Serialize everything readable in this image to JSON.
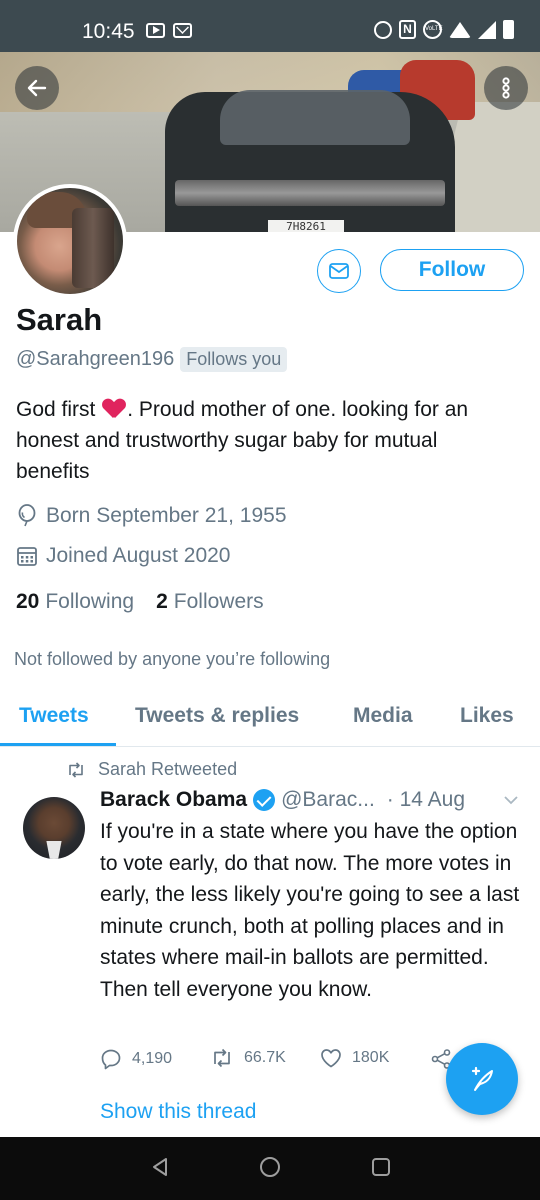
{
  "status_bar": {
    "time": "10:45",
    "nfc_label": "N",
    "volte_label": "VoLTE"
  },
  "header": {
    "license_plate": "7H8261"
  },
  "profile": {
    "display_name": "Sarah",
    "handle": "@Sarahgreen196",
    "follows_you_badge": "Follows you",
    "bio_part1": "God first",
    "bio_part2": ". Proud mother of one. looking for an honest and trustworthy sugar baby for mutual benefits",
    "born": "Born September 21, 1955",
    "joined": "Joined August 2020",
    "following_count": "20",
    "following_label": "Following",
    "followers_count": "2",
    "followers_label": "Followers",
    "not_followed_text": "Not followed by anyone you’re following",
    "follow_button_label": "Follow"
  },
  "tabs": [
    {
      "label": "Tweets",
      "active": true
    },
    {
      "label": "Tweets & replies",
      "active": false
    },
    {
      "label": "Media",
      "active": false
    },
    {
      "label": "Likes",
      "active": false
    }
  ],
  "tweet": {
    "retweeted_by": "Sarah Retweeted",
    "author": "Barack Obama",
    "handle": "@Barac...",
    "date": "· 14 Aug",
    "text": "If you're in a state where you have the option to vote early, do that now. The more votes in early, the less likely you're going to see a last minute crunch, both at polling places and in states where mail-in ballots are permitted. Then tell everyone you know.",
    "replies": "4,190",
    "retweets": "66.7K",
    "likes": "180K",
    "show_thread": "Show this thread"
  },
  "colors": {
    "accent": "#1da1f2",
    "text_primary": "#14171a",
    "text_secondary": "#657786",
    "heart": "#e0245e"
  },
  "icons": {
    "back": "arrow-left-icon",
    "more": "more-vertical-icon",
    "message": "envelope-icon",
    "birthday": "balloon-icon",
    "joined": "calendar-icon",
    "retweet": "retweet-icon",
    "reply": "reply-icon",
    "like": "heart-outline-icon",
    "share": "share-icon",
    "compose": "compose-feather-icon"
  }
}
